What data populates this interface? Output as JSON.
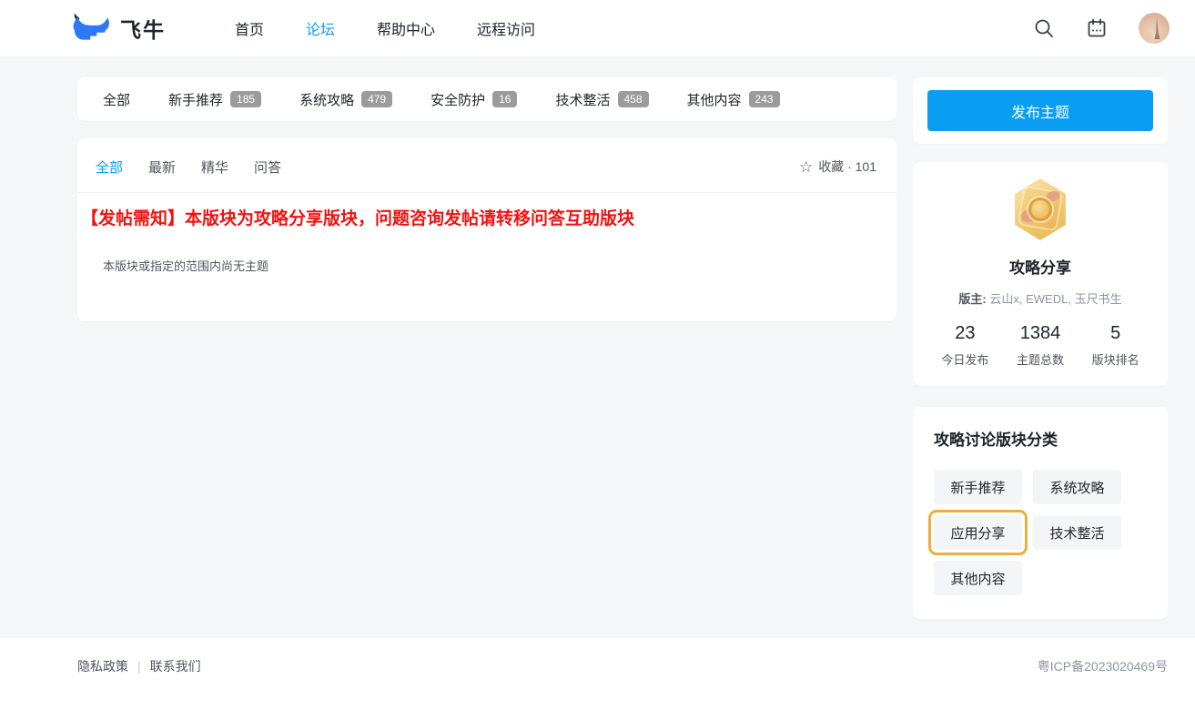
{
  "header": {
    "logo_text": "飞牛",
    "nav": [
      {
        "label": "首页",
        "active": false
      },
      {
        "label": "论坛",
        "active": true
      },
      {
        "label": "帮助中心",
        "active": false
      },
      {
        "label": "远程访问",
        "active": false
      }
    ]
  },
  "category_tabs": [
    {
      "label": "全部",
      "count": ""
    },
    {
      "label": "新手推荐",
      "count": "185"
    },
    {
      "label": "系统攻略",
      "count": "479"
    },
    {
      "label": "安全防护",
      "count": "16"
    },
    {
      "label": "技术整活",
      "count": "458"
    },
    {
      "label": "其他内容",
      "count": "243"
    }
  ],
  "filter_tabs": [
    {
      "label": "全部",
      "active": true
    },
    {
      "label": "最新",
      "active": false
    },
    {
      "label": "精华",
      "active": false
    },
    {
      "label": "问答",
      "active": false
    }
  ],
  "favorite": {
    "label": "收藏 · 101",
    "icon": "star"
  },
  "notice": "【发帖需知】本版块为攻略分享版块，问题咨询发帖请转移问答互助版块",
  "empty_text": "本版块或指定的范围内尚无主题",
  "sidebar": {
    "post_button_label": "发布主题",
    "panel": {
      "title": "攻略分享",
      "moderators_label": "版主:",
      "moderators": "云山x, EWEDL, 玉尺书生",
      "stats": [
        {
          "value": "23",
          "label": "今日发布"
        },
        {
          "value": "1384",
          "label": "主题总数"
        },
        {
          "value": "5",
          "label": "版块排名"
        }
      ]
    },
    "categories": {
      "title": "攻略讨论版块分类",
      "items": [
        {
          "label": "新手推荐",
          "highlighted": false
        },
        {
          "label": "系统攻略",
          "highlighted": false
        },
        {
          "label": "应用分享",
          "highlighted": true
        },
        {
          "label": "技术整活",
          "highlighted": false
        },
        {
          "label": "其他内容",
          "highlighted": false
        }
      ]
    }
  },
  "footer": {
    "links": [
      {
        "label": "隐私政策"
      },
      {
        "label": "联系我们"
      }
    ],
    "sep": "|",
    "icp": "粤ICP备2023020469号"
  },
  "colors": {
    "accent_blue": "#0a9ef2",
    "logo_blue": "#2e77f6",
    "notice_red": "#f01212",
    "badge_gray": "#9b9b9b",
    "highlight_orange": "#efae3c",
    "page_bg": "#f5f6f7"
  }
}
